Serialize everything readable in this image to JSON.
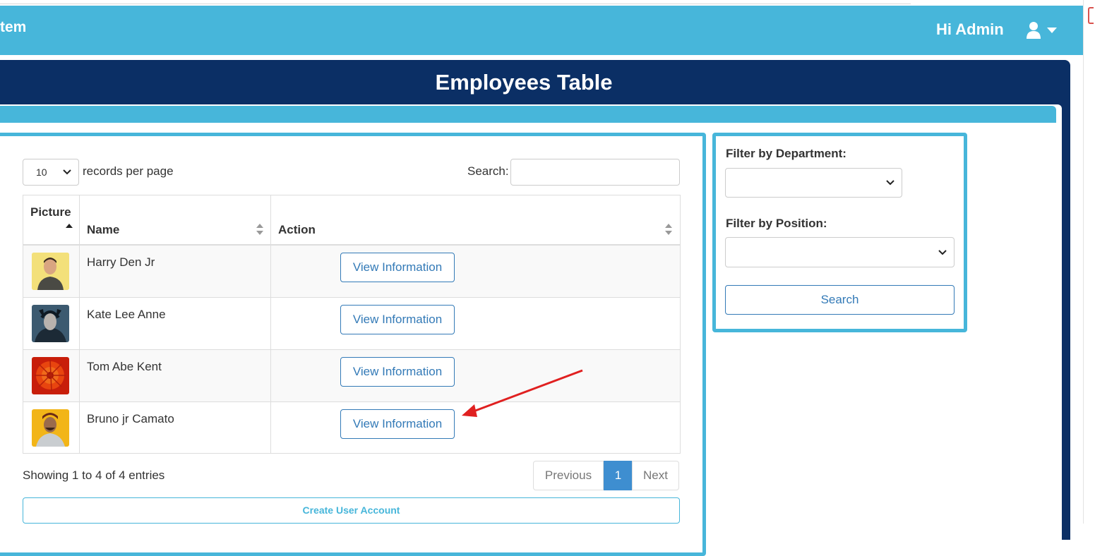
{
  "navbar": {
    "brand": "tem",
    "greeting": "Hi Admin",
    "user_icon": "user-icon",
    "caret_icon": "caret-down-icon",
    "color": "#47b6da"
  },
  "panel": {
    "title": "Employees Table",
    "color": "#0b2f65"
  },
  "table_controls": {
    "page_size": "10",
    "page_size_label": "records per page",
    "search_label": "Search:",
    "search_value": ""
  },
  "table": {
    "columns": [
      "Picture",
      "Name",
      "Action"
    ],
    "rows": [
      {
        "picture": "avatar-harry",
        "name": "Harry Den Jr",
        "action": "View Information"
      },
      {
        "picture": "avatar-kate",
        "name": "Kate Lee Anne",
        "action": "View Information"
      },
      {
        "picture": "avatar-tom",
        "name": "Tom Abe Kent",
        "action": "View Information"
      },
      {
        "picture": "avatar-bruno",
        "name": "Bruno jr Camato",
        "action": "View Information"
      }
    ]
  },
  "pagination": {
    "info": "Showing 1 to 4 of 4 entries",
    "previous": "Previous",
    "current": "1",
    "next": "Next"
  },
  "create_button": "Create User Account",
  "filters": {
    "department_label": "Filter by Department:",
    "department_value": "",
    "position_label": "Filter by Position:",
    "position_value": "",
    "search_button": "Search"
  },
  "annotation": {
    "arrow_color": "#e02020"
  }
}
